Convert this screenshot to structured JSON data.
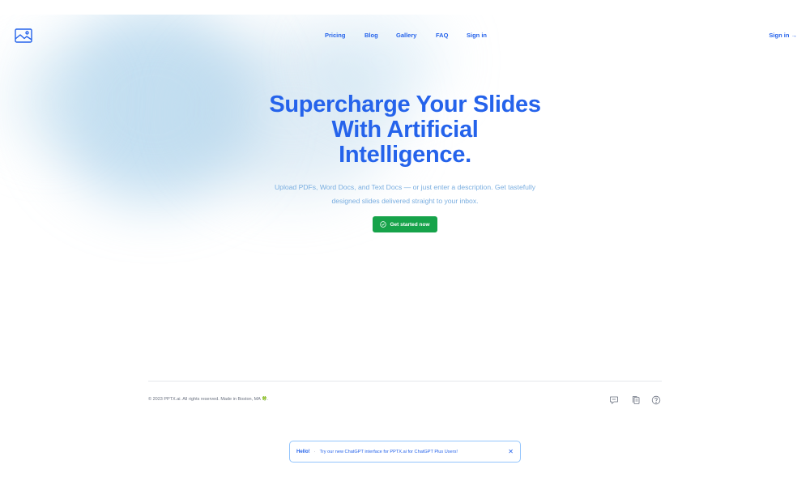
{
  "colors": {
    "brand": "#2563eb",
    "subtitle": "#7aaee0",
    "cta": "#16a34a",
    "muted": "#6b7280"
  },
  "header": {
    "logo_icon": "image-icon",
    "nav": [
      "Pricing",
      "Blog",
      "Gallery",
      "FAQ",
      "Sign in"
    ],
    "right_link": "Sign in →"
  },
  "hero": {
    "title_lines": [
      "Supercharge Your Slides",
      "With Artificial",
      "Intelligence."
    ],
    "subtitle_lines": [
      "Upload PDFs, Word Docs, and Text Docs — or just enter a description. Get tastefully",
      "designed slides delivered straight to your inbox."
    ],
    "cta_label": "Get started now",
    "cta_icon": "check-circle-icon"
  },
  "footer": {
    "copyright": "© 2023 PPTX.ai. All rights reserved. Made in Boston, MA 🍀.",
    "icons": [
      "chat-icon",
      "copy-icon",
      "help-icon"
    ]
  },
  "banner": {
    "strong": "Hello!",
    "separator": "·",
    "text": "Try our new ChatGPT interface for PPTX.ai for ChatGPT Plus Users!",
    "close": "✕"
  }
}
